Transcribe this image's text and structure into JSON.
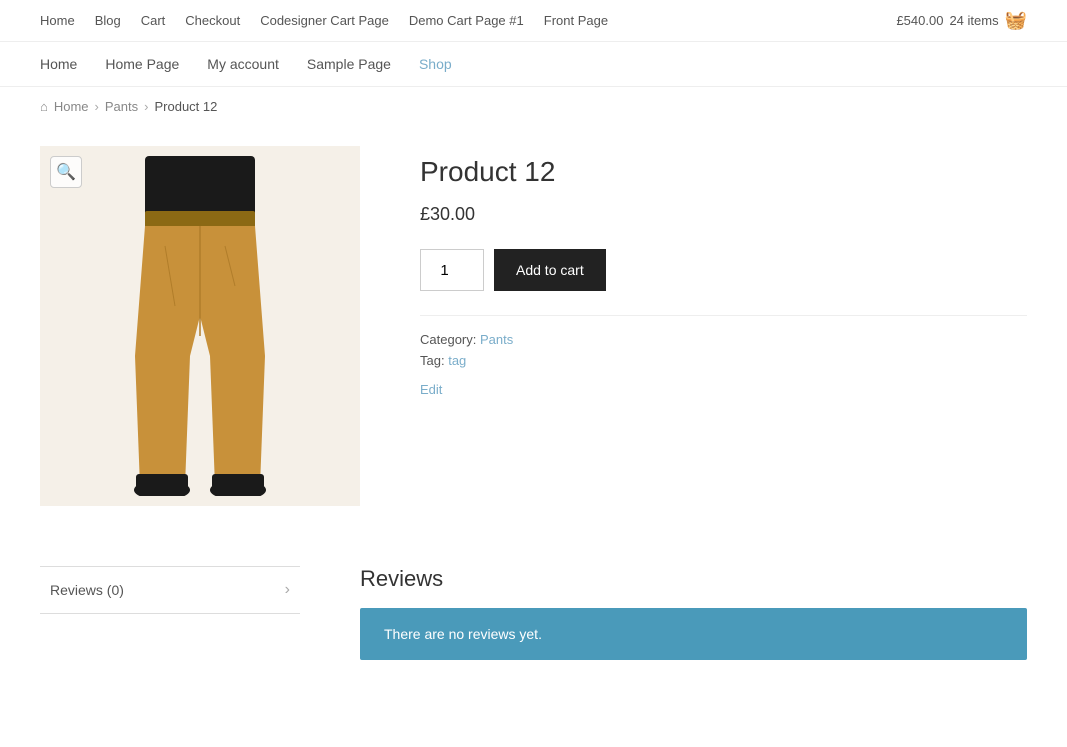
{
  "top_nav": {
    "links": [
      {
        "label": "Home",
        "href": "#"
      },
      {
        "label": "Blog",
        "href": "#"
      },
      {
        "label": "Cart",
        "href": "#"
      },
      {
        "label": "Checkout",
        "href": "#"
      },
      {
        "label": "Codesigner Cart Page",
        "href": "#"
      },
      {
        "label": "Demo Cart Page #1",
        "href": "#"
      },
      {
        "label": "Front Page",
        "href": "#"
      }
    ],
    "cart_total": "£540.00",
    "cart_items": "24 items"
  },
  "main_nav": {
    "links": [
      {
        "label": "Home",
        "href": "#"
      },
      {
        "label": "Home Page",
        "href": "#"
      },
      {
        "label": "My account",
        "href": "#"
      },
      {
        "label": "Sample Page",
        "href": "#"
      },
      {
        "label": "Shop",
        "href": "#"
      }
    ]
  },
  "breadcrumb": {
    "home_label": "Home",
    "pants_label": "Pants",
    "current_label": "Product 12"
  },
  "product": {
    "title": "Product 12",
    "price": "£30.00",
    "quantity": "1",
    "add_to_cart_label": "Add to cart",
    "category_label": "Category:",
    "category_value": "Pants",
    "tag_label": "Tag:",
    "tag_value": "tag",
    "edit_label": "Edit"
  },
  "reviews": {
    "tab_label": "Reviews (0)",
    "section_title": "Reviews",
    "no_reviews_text": "There are no reviews yet."
  },
  "icons": {
    "zoom": "🔍",
    "home": "⌂",
    "cart": "🛒",
    "chevron_right": "›"
  }
}
